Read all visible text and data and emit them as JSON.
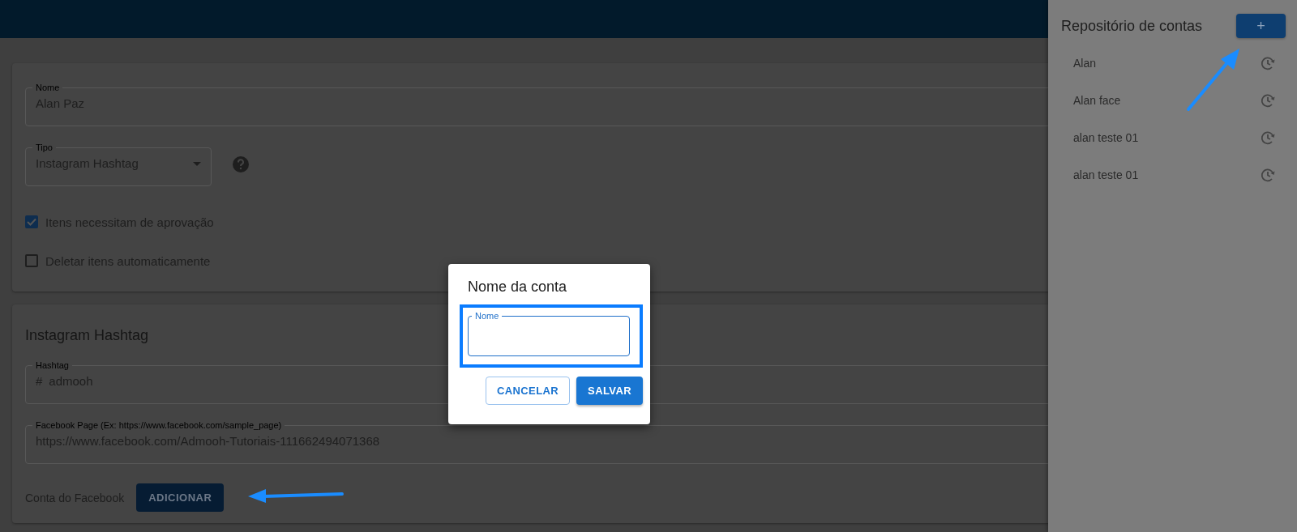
{
  "form": {
    "name_field": {
      "label": "Nome",
      "value": "Alan Paz"
    },
    "type_select": {
      "label": "Tipo",
      "value": "Instagram Hashtag"
    },
    "checkboxes": [
      {
        "label": "Itens necessitam de aprovação",
        "checked": true
      },
      {
        "label": "Deletar itens automaticamente",
        "checked": false
      }
    ],
    "section_title": "Instagram Hashtag",
    "hashtag_field": {
      "label": "Hashtag",
      "prefix": "#",
      "value": "admooh"
    },
    "facebook_page_field": {
      "label": "Facebook Page (Ex: https://www.facebook.com/sample_page)",
      "value": "https://www.facebook.com/Admooh-Tutoriais-111662494071368"
    },
    "facebook_account": {
      "label": "Conta do Facebook",
      "button": "ADICIONAR"
    }
  },
  "side_panel": {
    "title": "Repositório de contas",
    "add_button": "+",
    "accounts": [
      {
        "name": "Alan"
      },
      {
        "name": "Alan face"
      },
      {
        "name": "alan teste 01"
      },
      {
        "name": "alan teste 01"
      }
    ]
  },
  "dialog": {
    "title": "Nome da conta",
    "field": {
      "label": "Nome"
    },
    "buttons": [
      {
        "label": "CANCELAR",
        "kind": "outlined"
      },
      {
        "label": "SALVAR",
        "kind": "contained"
      }
    ]
  }
}
